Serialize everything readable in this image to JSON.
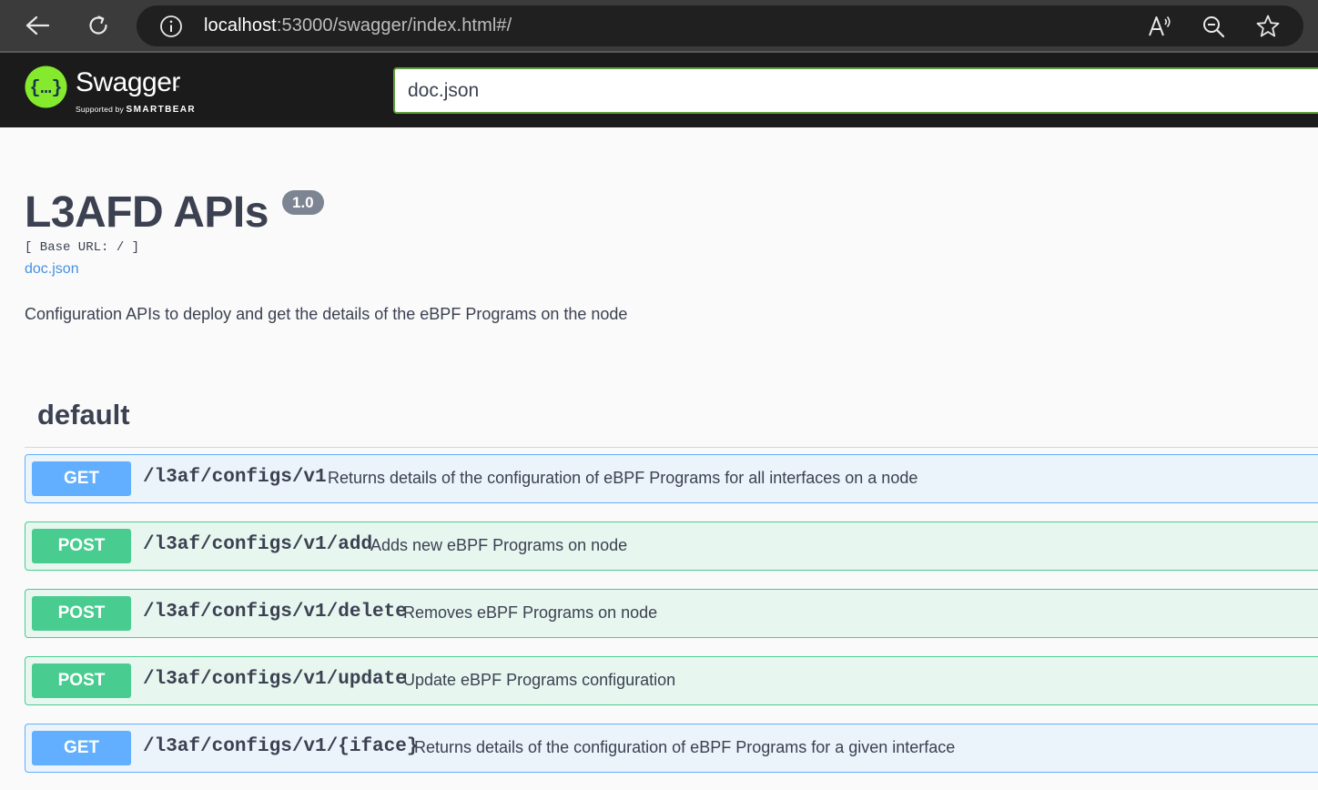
{
  "browser": {
    "url_host": "localhost",
    "url_rest": ":53000/swagger/index.html#/"
  },
  "swagger": {
    "logo_text": "Swagger",
    "logo_tm": "™",
    "logo_sub_prefix": "Supported by",
    "logo_sub_brand": "SMARTBEAR",
    "spec_url": "doc.json",
    "accent_color": "#85ea2d"
  },
  "info": {
    "title": "L3AFD APIs",
    "version": "1.0",
    "base_url": "[ Base URL: / ]",
    "doc_link": "doc.json",
    "description": "Configuration APIs to deploy and get the details of the eBPF Programs on the node"
  },
  "tag": {
    "name": "default"
  },
  "operations": [
    {
      "method": "GET",
      "path": "/l3af/configs/v1",
      "summary": "Returns details of the configuration of eBPF Programs for all interfaces on a node"
    },
    {
      "method": "POST",
      "path": "/l3af/configs/v1/add",
      "summary": "Adds new eBPF Programs on node"
    },
    {
      "method": "POST",
      "path": "/l3af/configs/v1/delete",
      "summary": "Removes eBPF Programs on node"
    },
    {
      "method": "POST",
      "path": "/l3af/configs/v1/update",
      "summary": "Update eBPF Programs configuration"
    },
    {
      "method": "GET",
      "path": "/l3af/configs/v1/{iface}",
      "summary": "Returns details of the configuration of eBPF Programs for a given interface"
    }
  ],
  "colors": {
    "get": "#61affe",
    "post": "#49cc90"
  }
}
